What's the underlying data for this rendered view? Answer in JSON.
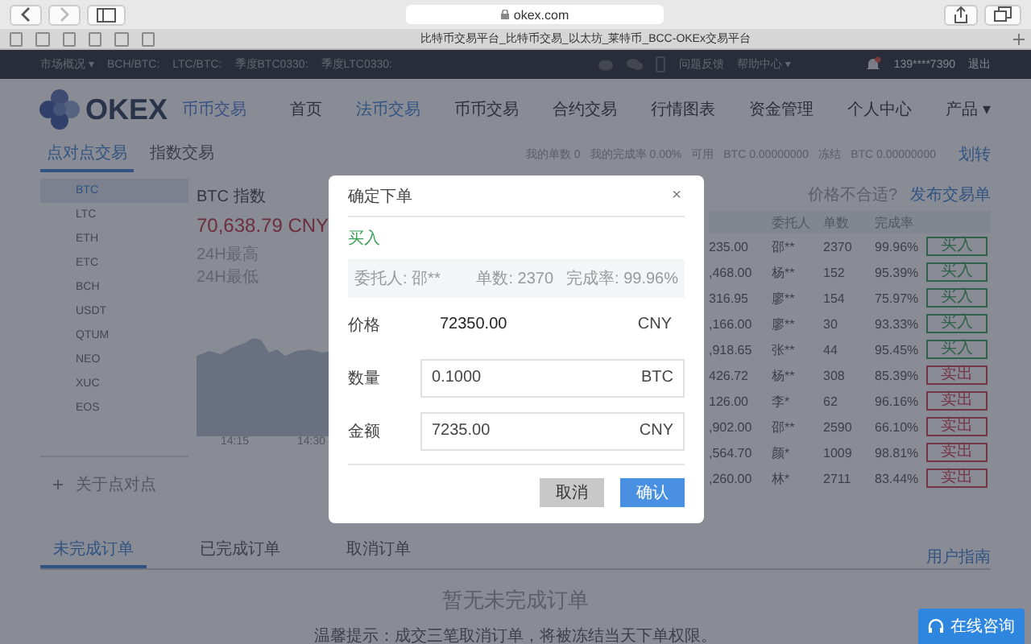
{
  "browser": {
    "url": "okex.com",
    "tab_title": "比特币交易平台_比特币交易_以太坊_莱特币_BCC-OKEx交易平台"
  },
  "ticker": {
    "market_menu": "市场概况 ▾",
    "pairs": [
      "BCH/BTC:",
      "LTC/BTC:",
      "季度BTC0330:",
      "季度LTC0330:"
    ],
    "feedback": "问题反馈",
    "help": "帮助中心 ▾",
    "phone": "139****7390",
    "logout": "退出"
  },
  "header": {
    "logo": "OKEX",
    "subtitle": "币币交易",
    "nav": [
      {
        "label": "首页",
        "selected": false
      },
      {
        "label": "法币交易",
        "selected": true
      },
      {
        "label": "币币交易",
        "selected": false
      },
      {
        "label": "合约交易",
        "selected": false
      },
      {
        "label": "行情图表",
        "selected": false
      },
      {
        "label": "资金管理",
        "selected": false
      },
      {
        "label": "个人中心",
        "selected": false
      },
      {
        "label": "产品 ▾",
        "selected": false
      }
    ]
  },
  "subnav": {
    "tabs": [
      {
        "label": "点对点交易",
        "selected": true
      },
      {
        "label": "指数交易",
        "selected": false
      }
    ],
    "stats": [
      "我的单数 0",
      "我的完成率 0.00%",
      "可用",
      "BTC 0.00000000",
      "冻结",
      "BTC 0.00000000"
    ],
    "transfer": "划转"
  },
  "coins": [
    {
      "label": "BTC",
      "selected": true
    },
    {
      "label": "LTC",
      "selected": false
    },
    {
      "label": "ETH",
      "selected": false
    },
    {
      "label": "ETC",
      "selected": false
    },
    {
      "label": "BCH",
      "selected": false
    },
    {
      "label": "USDT",
      "selected": false
    },
    {
      "label": "QTUM",
      "selected": false
    },
    {
      "label": "NEO",
      "selected": false
    },
    {
      "label": "XUC",
      "selected": false
    },
    {
      "label": "EOS",
      "selected": false
    }
  ],
  "about": "关于点对点",
  "index": {
    "title": "BTC 指数",
    "price": "70,638.79 CNY",
    "high": "24H最高",
    "low": "24H最低",
    "times": [
      "14:15",
      "14:30"
    ]
  },
  "offers": {
    "question": "价格不合适?",
    "publish": "发布交易单",
    "columns": [
      "委托人",
      "单数",
      "完成率"
    ],
    "rows": [
      {
        "price": "235.00",
        "user": "邵**",
        "orders": "2370",
        "rate": "99.96%",
        "action": "买入",
        "kind": "buy"
      },
      {
        "price": ",468.00",
        "user": "杨**",
        "orders": "152",
        "rate": "95.39%",
        "action": "买入",
        "kind": "buy"
      },
      {
        "price": "316.95",
        "user": "廖**",
        "orders": "154",
        "rate": "75.97%",
        "action": "买入",
        "kind": "buy"
      },
      {
        "price": ",166.00",
        "user": "廖**",
        "orders": "30",
        "rate": "93.33%",
        "action": "买入",
        "kind": "buy"
      },
      {
        "price": ",918.65",
        "user": "张**",
        "orders": "44",
        "rate": "95.45%",
        "action": "买入",
        "kind": "buy"
      },
      {
        "price": "426.72",
        "user": "杨**",
        "orders": "308",
        "rate": "85.39%",
        "action": "卖出",
        "kind": "sell"
      },
      {
        "price": "126.00",
        "user": "李*",
        "orders": "62",
        "rate": "96.16%",
        "action": "卖出",
        "kind": "sell"
      },
      {
        "price": ",902.00",
        "user": "邵**",
        "orders": "2590",
        "rate": "66.10%",
        "action": "卖出",
        "kind": "sell"
      },
      {
        "price": ",564.70",
        "user": "颜*",
        "orders": "1009",
        "rate": "98.81%",
        "action": "卖出",
        "kind": "sell"
      },
      {
        "price": ",260.00",
        "user": "林*",
        "orders": "2711",
        "rate": "83.44%",
        "action": "卖出",
        "kind": "sell"
      }
    ]
  },
  "orders": {
    "tabs": [
      {
        "label": "未完成订单",
        "selected": true
      },
      {
        "label": "已完成订单",
        "selected": false
      },
      {
        "label": "取消订单",
        "selected": false
      }
    ],
    "guide": "用户指南",
    "empty": "暂无未完成订单",
    "tip": "温馨提示：成交三笔取消订单，将被冻结当天下单权限。"
  },
  "chat_button": "在线咨询",
  "dialog": {
    "title": "确定下单",
    "close": "×",
    "side": "买入",
    "trader": "委托人: 邵**",
    "orders": "单数: 2370",
    "rate": "完成率: 99.96%",
    "fields": [
      {
        "label": "价格",
        "value": "72350.00",
        "unit": "CNY",
        "kind": "readonly"
      },
      {
        "label": "数量",
        "value": "0.1000",
        "unit": "BTC",
        "kind": "input"
      },
      {
        "label": "金额",
        "value": "7235.00",
        "unit": "CNY",
        "kind": "input"
      }
    ],
    "cancel": "取消",
    "confirm": "确认"
  }
}
